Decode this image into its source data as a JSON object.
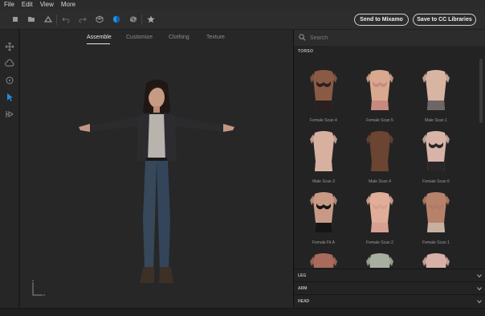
{
  "menu": [
    "File",
    "Edit",
    "View",
    "More"
  ],
  "toolbar": {
    "send_mixamo": "Send to Mixamo",
    "save_cc": "Save to CC Libraries"
  },
  "tabs": [
    "Assemble",
    "Customize",
    "Clothing",
    "Texture"
  ],
  "active_tab": "Assemble",
  "search": {
    "placeholder": "Search"
  },
  "sections": {
    "torso": "TORSO",
    "leg": "LEG",
    "arm": "ARM",
    "head": "HEAD"
  },
  "torso_items": [
    {
      "label": "Female Scan 4",
      "skin": "#8a5a45",
      "bra": "#2a2020",
      "pants": "#2a2020"
    },
    {
      "label": "Female Scan 5",
      "skin": "#d9a98f",
      "bra": "#c88a7e",
      "pants": "#c88a7e"
    },
    {
      "label": "Male Scan 1",
      "skin": "#d8b4a2",
      "bra": "",
      "pants": "#6e6666"
    },
    {
      "label": "Male Scan 3",
      "skin": "#d7b0a0",
      "bra": "",
      "pants": "#d7b0a0"
    },
    {
      "label": "Male Scan 4",
      "skin": "#6b4432",
      "bra": "",
      "pants": "#6b4432"
    },
    {
      "label": "Female Scan 6",
      "skin": "#d8b4a8",
      "bra": "#2a2626",
      "pants": "#2a2626"
    },
    {
      "label": "Female Fit A",
      "skin": "#c89a85",
      "bra": "#151515",
      "pants": "#151515"
    },
    {
      "label": "Female Scan 2",
      "skin": "#e0ad98",
      "bra": "#d8a090",
      "pants": "#d8a090"
    },
    {
      "label": "Female Scan 1",
      "skin": "#b7826a",
      "bra": "#b07a66",
      "pants": "#c8b0a0"
    },
    {
      "label": "",
      "skin": "#a86a5a",
      "bra": "",
      "pants": ""
    },
    {
      "label": "",
      "skin": "#a7b0a0",
      "bra": "",
      "pants": ""
    },
    {
      "label": "",
      "skin": "#d9b0a8",
      "bra": "",
      "pants": ""
    }
  ],
  "colors": {
    "accent": "#1e8fe6"
  }
}
